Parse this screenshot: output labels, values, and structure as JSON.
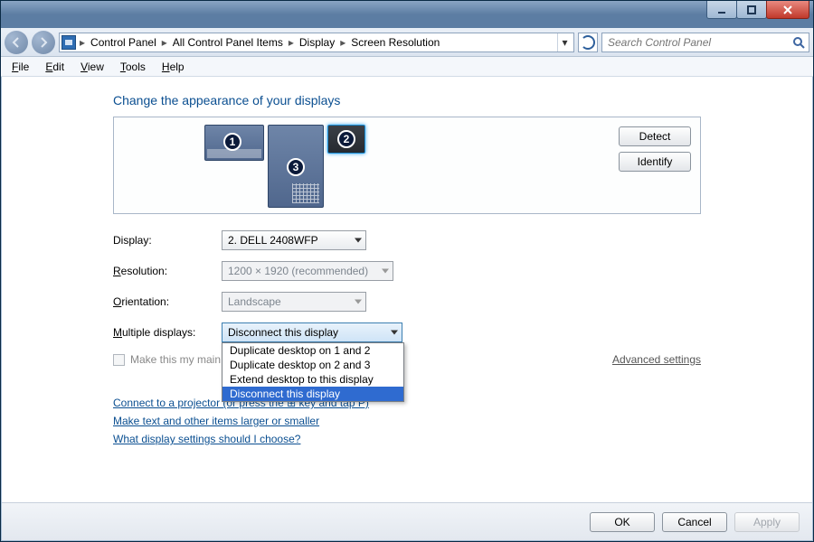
{
  "breadcrumbs": [
    "Control Panel",
    "All Control Panel Items",
    "Display",
    "Screen Resolution"
  ],
  "search_placeholder": "Search Control Panel",
  "menubar": [
    "File",
    "Edit",
    "View",
    "Tools",
    "Help"
  ],
  "page_title": "Change the appearance of your displays",
  "side_buttons": {
    "detect": "Detect",
    "identify": "Identify"
  },
  "monitors": [
    {
      "id": 1,
      "selected": false
    },
    {
      "id": 2,
      "selected": true
    },
    {
      "id": 3,
      "selected": false
    }
  ],
  "form": {
    "display_label": "Display:",
    "display_value": "2. DELL 2408WFP",
    "resolution_label": "Resolution:",
    "resolution_value": "1200 × 1920 (recommended)",
    "orientation_label": "Orientation:",
    "orientation_value": "Landscape",
    "multi_label": "Multiple displays:",
    "multi_value": "Disconnect this display",
    "multi_options": [
      "Duplicate desktop on 1 and 2",
      "Duplicate desktop on 2 and 3",
      "Extend desktop to this display",
      "Disconnect this display"
    ],
    "multi_selected_index": 3
  },
  "main_checkbox": "Make this my main display",
  "advanced_link": "Advanced settings",
  "links": [
    "Connect to a projector (or press the ⊞ key and tap P)",
    "Make text and other items larger or smaller",
    "What display settings should I choose?"
  ],
  "footer": {
    "ok": "OK",
    "cancel": "Cancel",
    "apply": "Apply"
  }
}
